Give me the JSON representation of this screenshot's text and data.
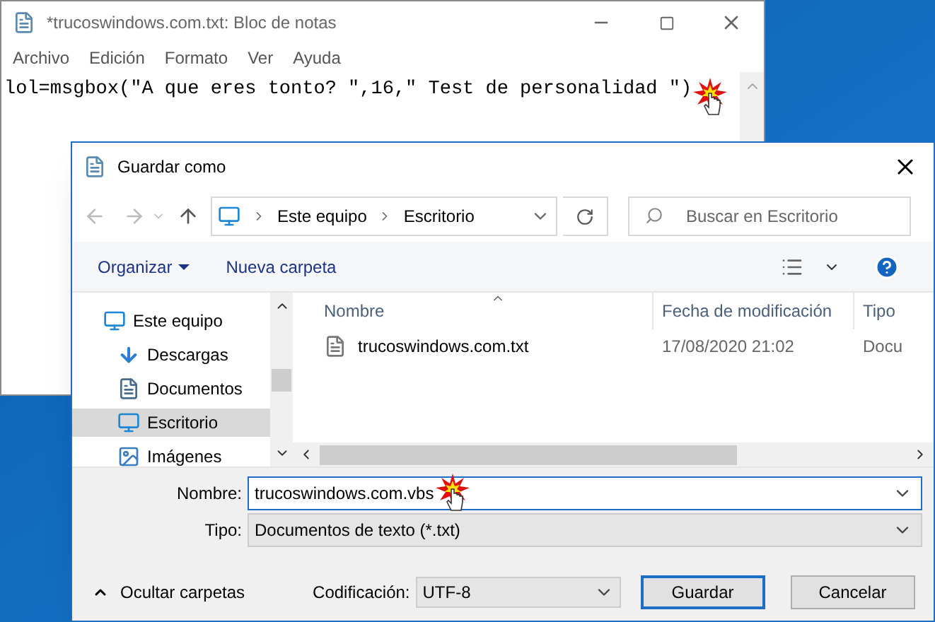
{
  "notepad": {
    "title": "*trucoswindows.com.txt: Bloc de notas",
    "menu": [
      "Archivo",
      "Edición",
      "Formato",
      "Ver",
      "Ayuda"
    ],
    "content": "lol=msgbox(\"A que eres tonto? \",16,\" Test de personalidad \")"
  },
  "dialog": {
    "title": "Guardar como",
    "breadcrumb": [
      "Este equipo",
      "Escritorio"
    ],
    "search": {
      "placeholder": "Buscar en Escritorio"
    },
    "toolbar": [
      "Organizar",
      "Nueva carpeta"
    ],
    "nav_items": [
      {
        "label": "Este equipo",
        "kind": "computer",
        "selected": false
      },
      {
        "label": "Descargas",
        "kind": "downloads",
        "selected": false
      },
      {
        "label": "Documentos",
        "kind": "documents",
        "selected": false
      },
      {
        "label": "Escritorio",
        "kind": "desktop",
        "selected": true
      },
      {
        "label": "Imágenes",
        "kind": "pictures",
        "selected": false
      }
    ],
    "columns": [
      "Nombre",
      "Fecha de modificación",
      "Tipo"
    ],
    "files": [
      {
        "name": "trucoswindows.com.txt",
        "date": "17/08/2020 21:02",
        "type": "Docu"
      }
    ],
    "filename": {
      "label": "Nombre:",
      "value": "trucoswindows.com.vbs"
    },
    "filetype": {
      "label": "Tipo:",
      "value": "Documentos de texto (*.txt)"
    },
    "hide_folders": "Ocultar carpetas",
    "encoding": {
      "label": "Codificación:",
      "value": "UTF-8"
    },
    "buttons": [
      "Guardar",
      "Cancelar"
    ]
  }
}
